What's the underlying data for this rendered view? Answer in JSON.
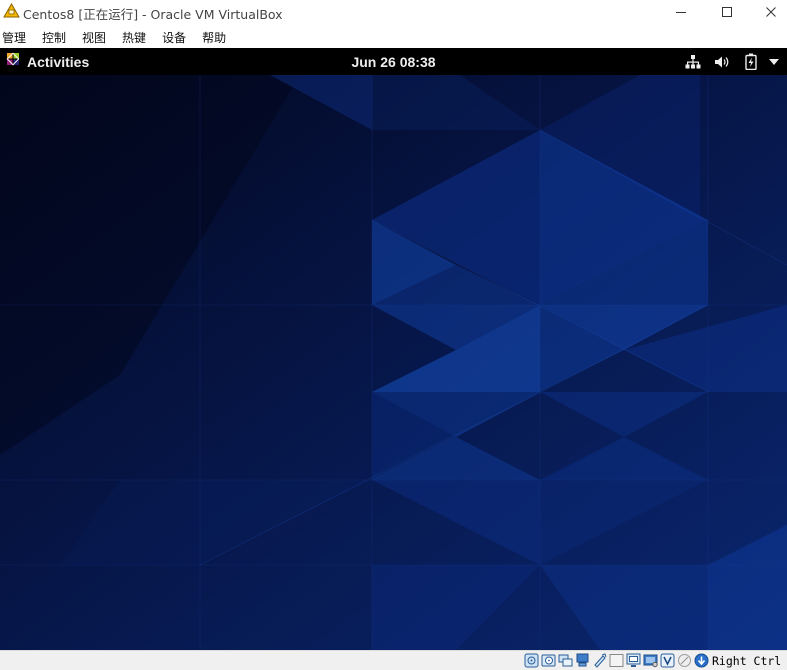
{
  "window": {
    "title": "Centos8 [正在运行] - Oracle VM VirtualBox",
    "icon": "virtualbox-icon"
  },
  "menu": {
    "items": [
      {
        "label": "管理"
      },
      {
        "label": "控制"
      },
      {
        "label": "视图"
      },
      {
        "label": "热键"
      },
      {
        "label": "设备"
      },
      {
        "label": "帮助"
      }
    ]
  },
  "guest": {
    "topbar": {
      "activities_label": "Activities",
      "clock": "Jun 26  08:38",
      "tray_icons": [
        "network-wired-icon",
        "volume-icon",
        "battery-charging-icon",
        "system-menu-arrow-icon"
      ]
    },
    "wallpaper": {
      "base_color": "#050b2a",
      "accent": "#1a4fb0"
    }
  },
  "statusbar": {
    "icons": [
      "hard-disk-icon",
      "optical-drive-icon",
      "audio-icon",
      "network-icon",
      "usb-icon",
      "shared-folders-icon",
      "display-icon",
      "video-capture-icon",
      "vt-x-icon",
      "mouse-integration-icon"
    ],
    "host_key_label": "Right Ctrl"
  }
}
